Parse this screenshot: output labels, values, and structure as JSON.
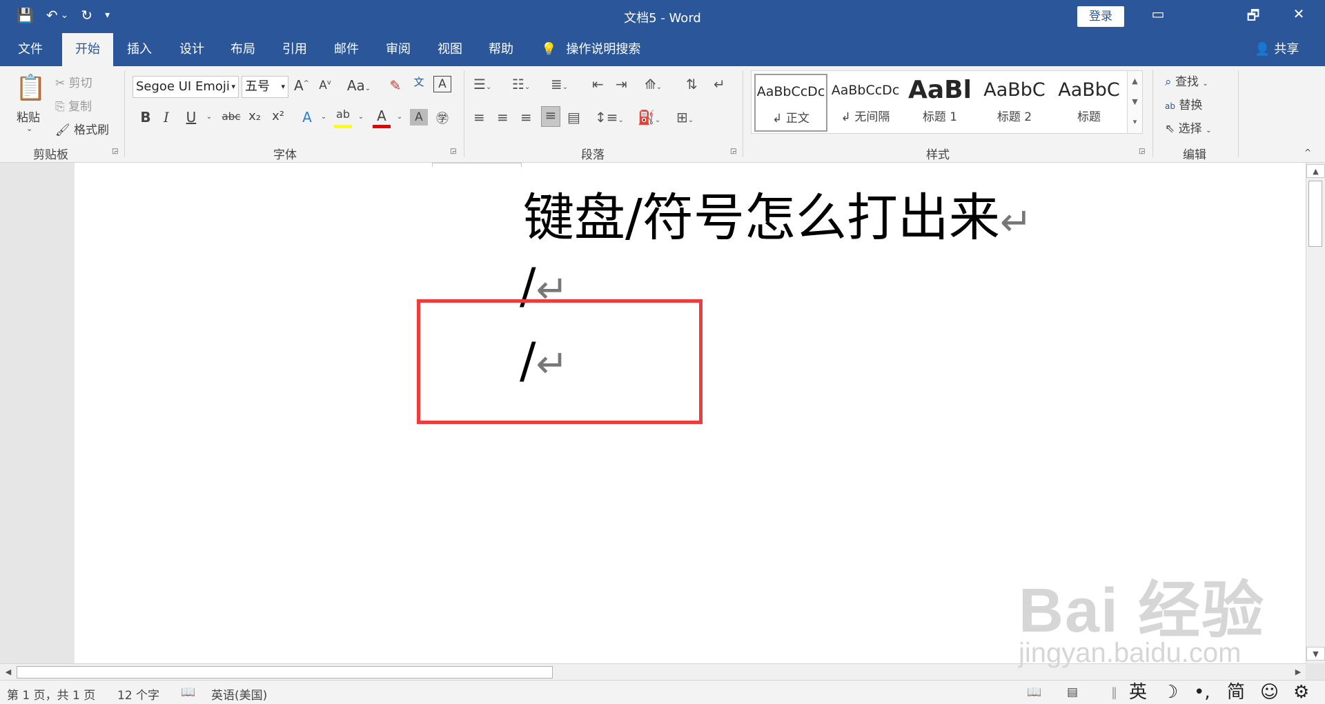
{
  "titlebar": {
    "title": "文档5  -  Word",
    "login": "登录",
    "qat": [
      "💾",
      "↶",
      "⌄",
      "↻",
      "▾"
    ],
    "window_controls": [
      "▭",
      "🗗",
      "✕"
    ]
  },
  "tabs": [
    "文件",
    "开始",
    "插入",
    "设计",
    "布局",
    "引用",
    "邮件",
    "审阅",
    "视图",
    "帮助"
  ],
  "tell_me": "操作说明搜索",
  "share": "共享",
  "ribbon": {
    "clipboard": {
      "paste": "粘贴",
      "cut": "剪切",
      "copy": "复制",
      "format_painter": "格式刷",
      "label": "剪贴板"
    },
    "font": {
      "font_name": "Segoe UI Emoji",
      "font_size": "五号",
      "label": "字体",
      "buttons": [
        "B",
        "I",
        "U",
        "abc",
        "x₂",
        "x²"
      ]
    },
    "paragraph": {
      "label": "段落"
    },
    "styles": {
      "label": "样式",
      "items": [
        {
          "sample": "AaBbCcDc",
          "name": "↲ 正文"
        },
        {
          "sample": "AaBbCcDc",
          "name": "↲ 无间隔"
        },
        {
          "sample": "AaBl",
          "name": "标题 1"
        },
        {
          "sample": "AaBbC",
          "name": "标题 2"
        },
        {
          "sample": "AaBbC",
          "name": "标题"
        }
      ]
    },
    "editing": {
      "label": "编辑",
      "find": "查找",
      "replace": "替换",
      "select": "选择"
    }
  },
  "document": {
    "heading": "键盘/符号怎么打出来",
    "line1": "/",
    "line2": "/",
    "para_mark": "↵"
  },
  "statusbar": {
    "page": "第 1 页，共 1 页",
    "words": "12 个字",
    "language": "英语(美国)",
    "ime_mode": "英",
    "ime_moon": "☽",
    "ime_punct": "•,",
    "ime_simplified": "简",
    "ime_emoji": "☺",
    "ime_settings": "⚙"
  },
  "watermark": {
    "brand": "Bai 经验",
    "url": "jingyan.baidu.com"
  },
  "colors": {
    "word_blue": "#2b579a",
    "highlight_red": "#ee3b3b"
  }
}
